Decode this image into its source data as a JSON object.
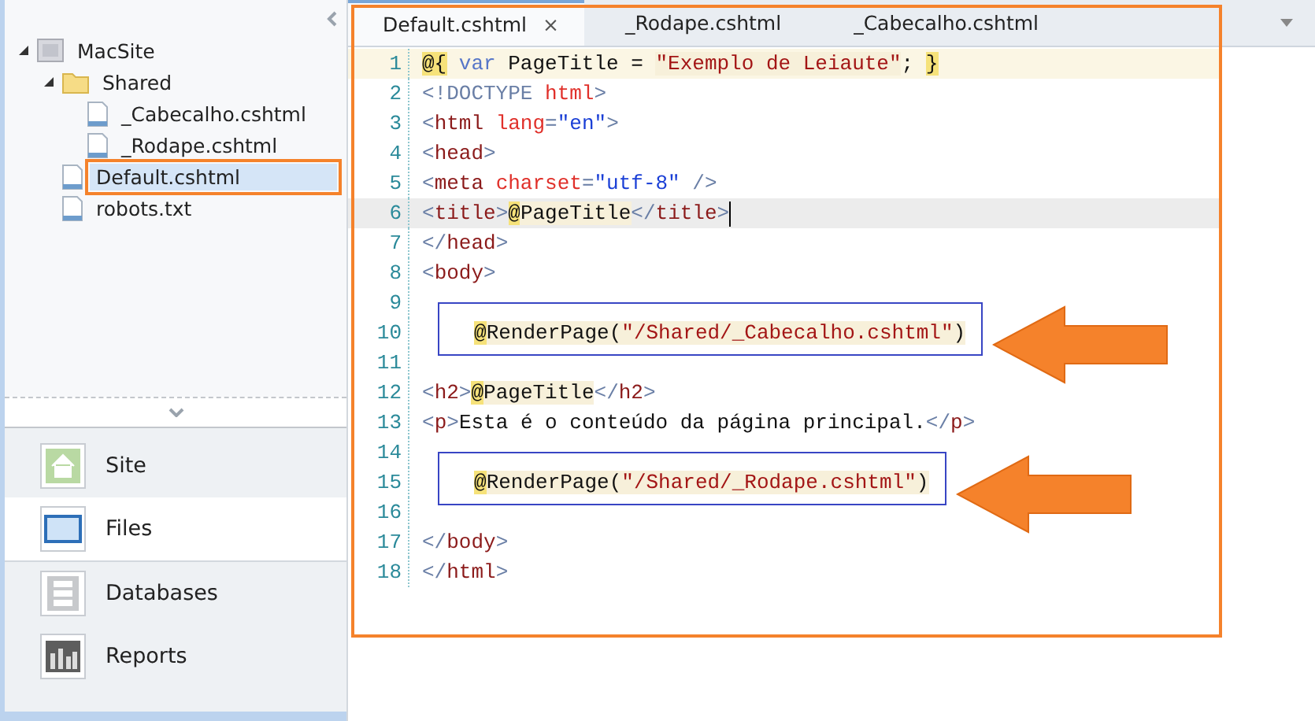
{
  "sidebar": {
    "tree": [
      {
        "label": "MacSite",
        "kind": "site",
        "expanded": true,
        "selected": false,
        "highlighted": false,
        "children": [
          {
            "label": "Shared",
            "kind": "folder",
            "expanded": true,
            "selected": false,
            "highlighted": false,
            "children": [
              {
                "label": "_Cabecalho.cshtml",
                "kind": "file",
                "selected": false,
                "highlighted": false
              },
              {
                "label": "_Rodape.cshtml",
                "kind": "file",
                "selected": false,
                "highlighted": false
              }
            ]
          },
          {
            "label": "Default.cshtml",
            "kind": "file",
            "selected": true,
            "highlighted": true
          },
          {
            "label": "robots.txt",
            "kind": "file",
            "selected": false,
            "highlighted": false
          }
        ]
      }
    ],
    "workspaces": [
      {
        "label": "Site",
        "kind": "site",
        "selected": false
      },
      {
        "label": "Files",
        "kind": "files",
        "selected": true
      },
      {
        "label": "Databases",
        "kind": "databases",
        "selected": false
      },
      {
        "label": "Reports",
        "kind": "reports",
        "selected": false
      }
    ]
  },
  "tabs": [
    {
      "label": "Default.cshtml",
      "close": "×",
      "selected": true
    },
    {
      "label": "_Rodape.cshtml",
      "selected": false
    },
    {
      "label": "_Cabecalho.cshtml",
      "selected": false
    }
  ],
  "editor": {
    "lines": [
      {
        "number": "1",
        "kind": "razor",
        "current": false,
        "callout": false,
        "segments": [
          {
            "text": "@{",
            "kind": "razor"
          },
          {
            "text": " var ",
            "kind": "keyword"
          },
          {
            "text": "PageTitle = ",
            "kind": "text"
          },
          {
            "text": "\"Exemplo de Leiaute\"",
            "kind": "string"
          },
          {
            "text": "; ",
            "kind": "text"
          },
          {
            "text": "}",
            "kind": "razor"
          }
        ]
      },
      {
        "number": "2",
        "kind": "markup",
        "current": false,
        "callout": false,
        "segments": [
          {
            "text": "<!DOCTYPE ",
            "kind": "punct"
          },
          {
            "text": "html",
            "kind": "attr"
          },
          {
            "text": ">",
            "kind": "punct"
          }
        ]
      },
      {
        "number": "3",
        "kind": "markup",
        "current": false,
        "callout": false,
        "segments": [
          {
            "text": "<",
            "kind": "punct"
          },
          {
            "text": "html ",
            "kind": "tag"
          },
          {
            "text": "lang",
            "kind": "attr"
          },
          {
            "text": "=",
            "kind": "punct"
          },
          {
            "text": "\"en\"",
            "kind": "value"
          },
          {
            "text": ">",
            "kind": "punct"
          }
        ]
      },
      {
        "number": "4",
        "kind": "markup",
        "current": false,
        "callout": false,
        "segments": [
          {
            "text": "<",
            "kind": "punct"
          },
          {
            "text": "head",
            "kind": "tag"
          },
          {
            "text": ">",
            "kind": "punct"
          }
        ]
      },
      {
        "number": "5",
        "kind": "markup",
        "current": false,
        "callout": false,
        "segments": [
          {
            "text": "<",
            "kind": "punct"
          },
          {
            "text": "meta ",
            "kind": "tag"
          },
          {
            "text": "charset",
            "kind": "attr"
          },
          {
            "text": "=",
            "kind": "punct"
          },
          {
            "text": "\"utf-8\"",
            "kind": "value"
          },
          {
            "text": " />",
            "kind": "punct"
          }
        ]
      },
      {
        "number": "6",
        "kind": "markup",
        "current": true,
        "callout": false,
        "segments": [
          {
            "text": "<",
            "kind": "punct"
          },
          {
            "text": "title",
            "kind": "tag"
          },
          {
            "text": ">",
            "kind": "punct"
          },
          {
            "text": "@",
            "kind": "razor"
          },
          {
            "text": "PageTitle",
            "kind": "code"
          },
          {
            "text": "</",
            "kind": "punct"
          },
          {
            "text": "title",
            "kind": "tag"
          },
          {
            "text": ">",
            "kind": "punct"
          }
        ]
      },
      {
        "number": "7",
        "kind": "markup",
        "current": false,
        "callout": false,
        "segments": [
          {
            "text": "</",
            "kind": "punct"
          },
          {
            "text": "head",
            "kind": "tag"
          },
          {
            "text": ">",
            "kind": "punct"
          }
        ]
      },
      {
        "number": "8",
        "kind": "markup",
        "current": false,
        "callout": false,
        "segments": [
          {
            "text": "<",
            "kind": "punct"
          },
          {
            "text": "body",
            "kind": "tag"
          },
          {
            "text": ">",
            "kind": "punct"
          }
        ]
      },
      {
        "number": "9",
        "kind": "markup",
        "current": false,
        "callout": false
      },
      {
        "number": "10",
        "kind": "markup",
        "current": false,
        "callout": true,
        "segments": [
          {
            "text": "@",
            "kind": "razor"
          },
          {
            "text": "RenderPage(",
            "kind": "code"
          },
          {
            "text": "\"/Shared/_Cabecalho.cshtml\"",
            "kind": "string"
          },
          {
            "text": ")",
            "kind": "code"
          }
        ]
      },
      {
        "number": "11",
        "kind": "markup",
        "current": false,
        "callout": false
      },
      {
        "number": "12",
        "kind": "markup",
        "current": false,
        "callout": false,
        "segments": [
          {
            "text": "<",
            "kind": "punct"
          },
          {
            "text": "h2",
            "kind": "tag"
          },
          {
            "text": ">",
            "kind": "punct"
          },
          {
            "text": "@",
            "kind": "razor"
          },
          {
            "text": "PageTitle",
            "kind": "code"
          },
          {
            "text": "</",
            "kind": "punct"
          },
          {
            "text": "h2",
            "kind": "tag"
          },
          {
            "text": ">",
            "kind": "punct"
          }
        ]
      },
      {
        "number": "13",
        "kind": "markup",
        "current": false,
        "callout": false,
        "segments": [
          {
            "text": "<",
            "kind": "punct"
          },
          {
            "text": "p",
            "kind": "tag"
          },
          {
            "text": ">",
            "kind": "punct"
          },
          {
            "text": "Esta é o conteúdo da página principal.",
            "kind": "text"
          },
          {
            "text": "</",
            "kind": "punct"
          },
          {
            "text": "p",
            "kind": "tag"
          },
          {
            "text": ">",
            "kind": "punct"
          }
        ]
      },
      {
        "number": "14",
        "kind": "markup",
        "current": false,
        "callout": false
      },
      {
        "number": "15",
        "kind": "markup",
        "current": false,
        "callout": true,
        "segments": [
          {
            "text": "@",
            "kind": "razor"
          },
          {
            "text": "RenderPage(",
            "kind": "code"
          },
          {
            "text": "\"/Shared/_Rodape.cshtml\"",
            "kind": "string"
          },
          {
            "text": ")",
            "kind": "code"
          }
        ]
      },
      {
        "number": "16",
        "kind": "markup",
        "current": false,
        "callout": false
      },
      {
        "number": "17",
        "kind": "markup",
        "current": false,
        "callout": false,
        "segments": [
          {
            "text": "</",
            "kind": "punct"
          },
          {
            "text": "body",
            "kind": "tag"
          },
          {
            "text": ">",
            "kind": "punct"
          }
        ]
      },
      {
        "number": "18",
        "kind": "markup",
        "current": false,
        "callout": false,
        "segments": [
          {
            "text": "</",
            "kind": "punct"
          },
          {
            "text": "html",
            "kind": "tag"
          },
          {
            "text": ">",
            "kind": "punct"
          }
        ]
      }
    ]
  }
}
